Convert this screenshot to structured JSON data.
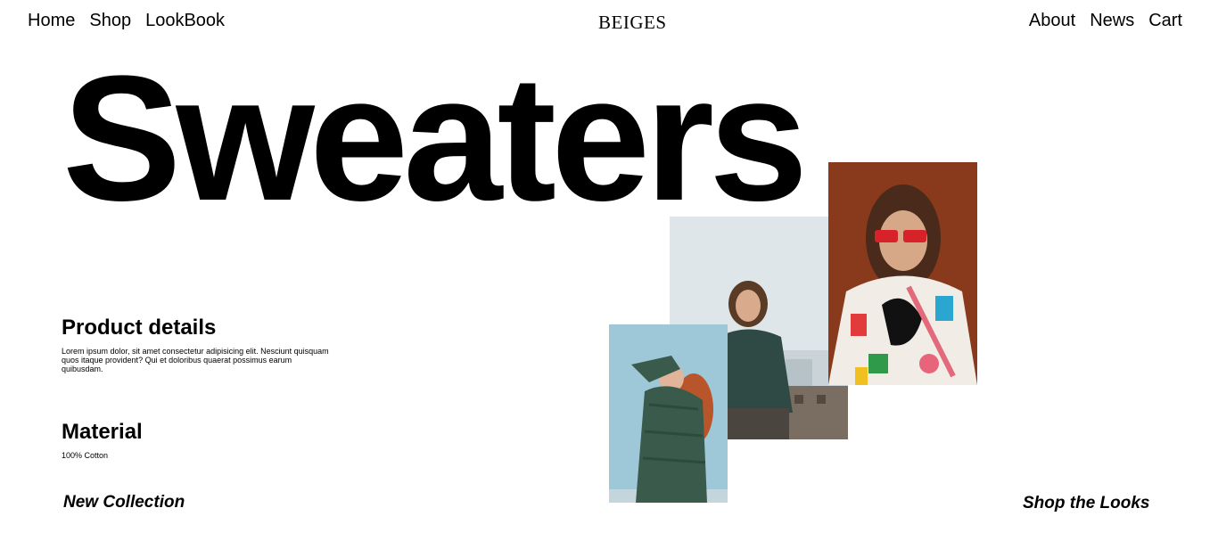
{
  "nav": {
    "left": [
      "Home",
      "Shop",
      "LookBook"
    ],
    "right": [
      "About",
      "News",
      "Cart"
    ]
  },
  "brand": "BEIGES",
  "hero_title": "Sweaters",
  "product_details": {
    "title": "Product details",
    "text": "Lorem ipsum dolor, sit amet consectetur adipisicing elit. Nesciunt quisquam quos itaque provident? Qui et doloribus quaerat possimus earum quibusdam."
  },
  "material": {
    "title": "Material",
    "text": "100% Cotton"
  },
  "links": {
    "new_collection": "New Collection",
    "shop_the_looks": "Shop the Looks"
  },
  "colors": {
    "text": "#000000",
    "background": "#ffffff",
    "photo_bg_orange": "#8a3a1c",
    "sweater_green": "#3a5a4c",
    "sky": "#9ec7d8"
  }
}
